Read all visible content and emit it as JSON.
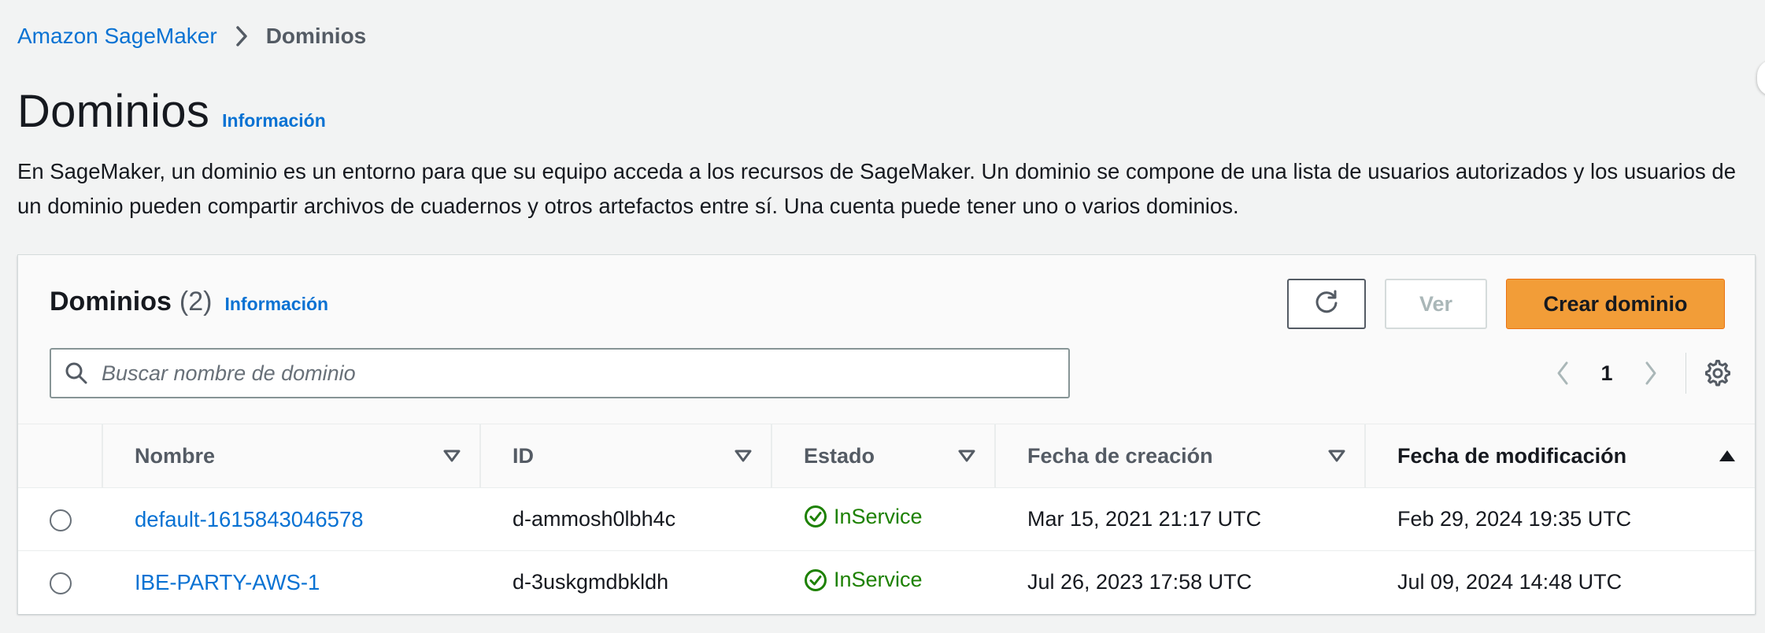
{
  "breadcrumb": {
    "parent": "Amazon SageMaker",
    "current": "Dominios"
  },
  "page": {
    "title": "Dominios",
    "info_link": "Información",
    "description": "En SageMaker, un dominio es un entorno para que su equipo acceda a los recursos de SageMaker. Un dominio se compone de una lista de usuarios autorizados y los usuarios de un dominio pueden compartir archivos de cuadernos y otros artefactos entre sí. Una cuenta puede tener uno o varios dominios."
  },
  "panel": {
    "title": "Dominios",
    "count": "(2)",
    "info_link": "Información",
    "buttons": {
      "refresh_icon": "refresh-icon",
      "view_label": "Ver",
      "create_label": "Crear dominio"
    },
    "search": {
      "placeholder": "Buscar nombre de dominio",
      "value": ""
    },
    "pagination": {
      "current_page": "1"
    }
  },
  "table": {
    "columns": [
      {
        "label": "Nombre",
        "sort": "none"
      },
      {
        "label": "ID",
        "sort": "none"
      },
      {
        "label": "Estado",
        "sort": "none"
      },
      {
        "label": "Fecha de creación",
        "sort": "none"
      },
      {
        "label": "Fecha de modificación",
        "sort": "ascending"
      }
    ],
    "rows": [
      {
        "name": "default-1615843046578",
        "id": "d-ammosh0lbh4c",
        "status": "InService",
        "created": "Mar 15, 2021 21:17 UTC",
        "modified": "Feb 29, 2024 19:35 UTC"
      },
      {
        "name": "IBE-PARTY-AWS-1",
        "id": "d-3uskgmdbkldh",
        "status": "InService",
        "created": "Jul 26, 2023 17:58 UTC",
        "modified": "Jul 09, 2024 14:48 UTC"
      }
    ]
  },
  "colors": {
    "link": "#0972d3",
    "primary_button": "#f29d38",
    "success": "#1d8102",
    "background": "#f2f3f3"
  }
}
